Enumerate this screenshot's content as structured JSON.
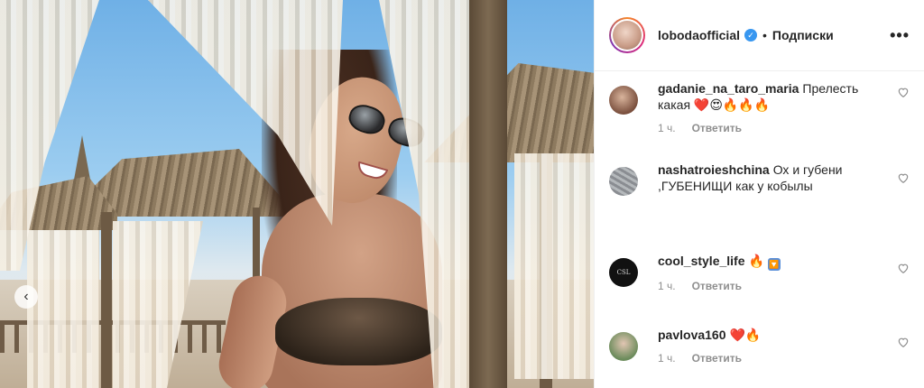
{
  "header": {
    "username": "lobodaofficial",
    "verified": true,
    "separator": "•",
    "follow_label": "Подписки",
    "more_label": "•••"
  },
  "photo": {
    "prev_arrow": "‹"
  },
  "comments": [
    {
      "username": "gadanie_na_taro_maria",
      "text": "Прелесть какая ❤️😍🔥🔥🔥",
      "time": "1 ч.",
      "reply": "Ответить",
      "avatar": "woman-portrait"
    },
    {
      "username": "nashatroieshchina",
      "text": "Ох и губени ,ГУБЕНИЩИ как у кобылы",
      "time": "",
      "reply": "",
      "avatar": "gray-texture"
    },
    {
      "username": "cool_style_life",
      "text": "🔥",
      "emoji_square": "🔽",
      "time": "1 ч.",
      "reply": "Ответить",
      "avatar": "logo-black",
      "avatar_text": "CSL"
    },
    {
      "username": "pavlova160",
      "text": "❤️🔥",
      "time": "1 ч.",
      "reply": "Ответить",
      "avatar": "woman-green"
    }
  ],
  "colors": {
    "verified_blue": "#3897f0",
    "meta_gray": "#8e8e8e",
    "text": "#262626"
  }
}
